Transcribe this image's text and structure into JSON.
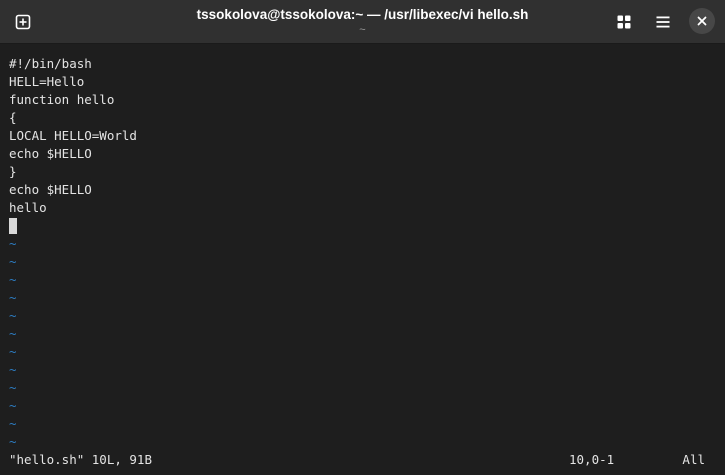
{
  "window": {
    "title": "tssokolova@tssokolova:~ — /usr/libexec/vi hello.sh",
    "subtitle": "~"
  },
  "titlebar_icons": {
    "new_tab": "new-tab-icon",
    "tab_overview": "grid-icon",
    "menu": "hamburger-menu-icon",
    "close": "close-icon"
  },
  "editor": {
    "lines": [
      "#!/bin/bash",
      "HELL=Hello",
      "function hello",
      "{",
      "LOCAL HELLO=World",
      "echo $HELLO",
      "}",
      "echo $HELLO",
      "hello"
    ],
    "empty_line_marker": "~",
    "empty_line_count": 12
  },
  "status": {
    "file_info": "\"hello.sh\" 10L, 91B",
    "position": "10,0-1",
    "scroll": "All"
  },
  "colors": {
    "background": "#1e1e1e",
    "titlebar": "#303030",
    "text": "#e4e4e4",
    "tilde": "#2d7cc1",
    "cursor": "#d9d9d9"
  }
}
